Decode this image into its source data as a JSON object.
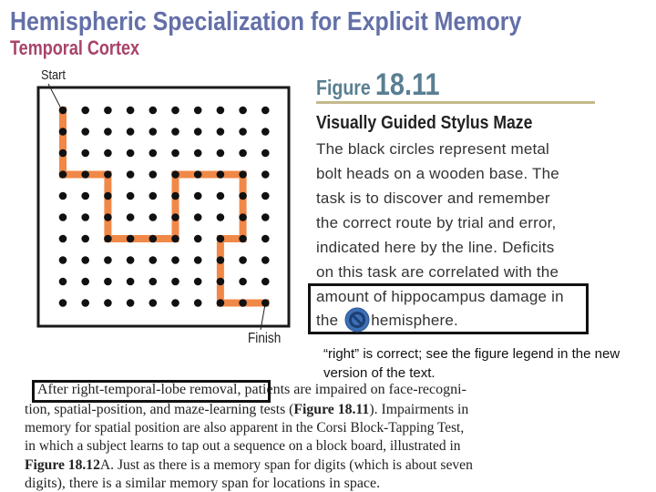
{
  "slide": {
    "title": "Hemispheric Specialization for Explicit Memory",
    "subtitle": "Temporal Cortex"
  },
  "figure": {
    "label_word": "Figure",
    "label_number": "18.11",
    "start_label": "Start",
    "finish_label": "Finish",
    "caption_title": "Visually Guided Stylus Maze",
    "caption_lines": [
      "The black circles represent metal",
      "bolt heads on a wooden base. The",
      "task is to discover and remember",
      "the correct route by trial and error,",
      "indicated here by the line. Deficits",
      "on this task are correlated with the",
      "amount of hippocampus damage in"
    ],
    "caption_last_before": "the",
    "caption_last_after": "hemisphere.",
    "overlay_icon": "ban-icon",
    "maze": {
      "grid_columns": 10,
      "grid_rows": 10,
      "path_color": "#f08848",
      "dot_color": "#111111",
      "path_points": [
        [
          0,
          0
        ],
        [
          0,
          3
        ],
        [
          2,
          3
        ],
        [
          2,
          6
        ],
        [
          5,
          6
        ],
        [
          5,
          3
        ],
        [
          8,
          3
        ],
        [
          8,
          6
        ],
        [
          7,
          6
        ],
        [
          7,
          9
        ],
        [
          9,
          9
        ]
      ]
    }
  },
  "note": "“right” is correct; see the figure legend in the new version of the text.",
  "body_text": {
    "lines": [
      {
        "parts": [
          {
            "t": "After right-temporal-lobe removal,",
            "b": false
          },
          {
            "t": " patients are impaired on face-recogni-",
            "b": false
          }
        ]
      },
      {
        "parts": [
          {
            "t": "tion, spatial-position, and maze-learning tests (",
            "b": false
          },
          {
            "t": "Figure 18.11",
            "b": true
          },
          {
            "t": "). Impairments in",
            "b": false
          }
        ]
      },
      {
        "parts": [
          {
            "t": "memory for spatial position are also apparent in the Corsi Block-Tapping Test,",
            "b": false
          }
        ]
      },
      {
        "parts": [
          {
            "t": "in which a subject learns to tap out a sequence on a block board, illustrated in",
            "b": false
          }
        ]
      },
      {
        "parts": [
          {
            "t": "Figure 18.12",
            "b": true
          },
          {
            "t": "A. Just as there is a memory span for digits (which is about seven",
            "b": false
          }
        ]
      },
      {
        "parts": [
          {
            "t": "digits), there is a similar memory span for locations in space.",
            "b": false
          }
        ]
      }
    ]
  }
}
